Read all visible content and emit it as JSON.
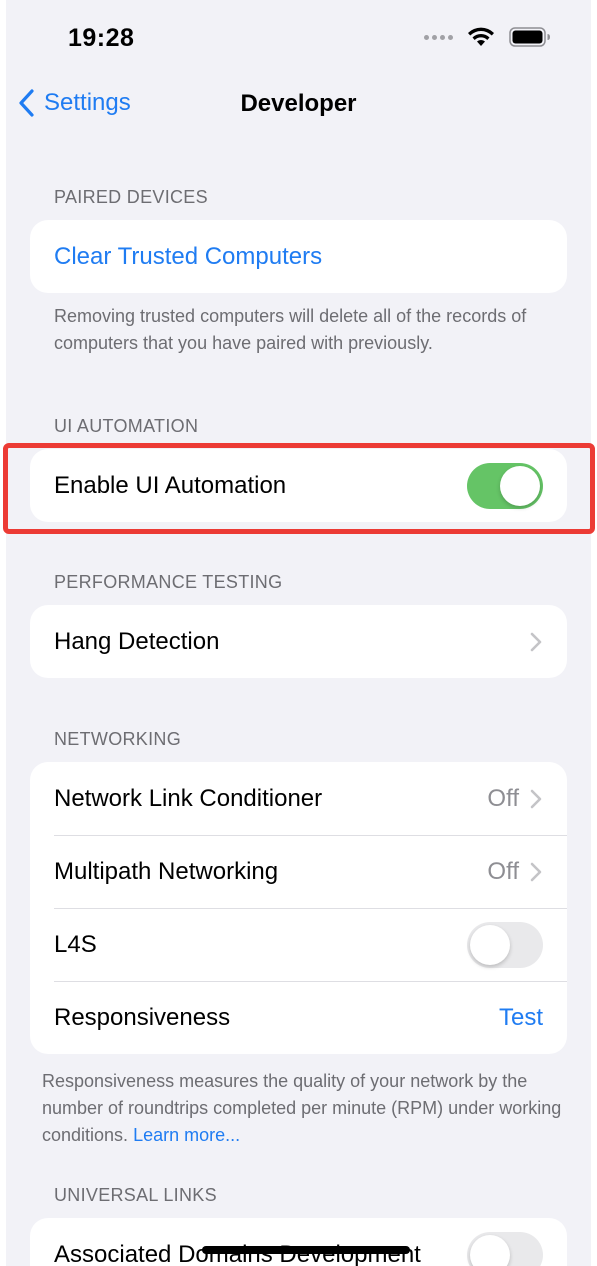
{
  "status_bar": {
    "time": "19:28"
  },
  "nav": {
    "back_label": "Settings",
    "title": "Developer"
  },
  "paired_devices": {
    "header": "PAIRED DEVICES",
    "clear_label": "Clear Trusted Computers",
    "footer": "Removing trusted computers will delete all of the records of computers that you have paired with previously."
  },
  "ui_automation": {
    "header": "UI AUTOMATION",
    "enable_label": "Enable UI Automation",
    "enabled": true
  },
  "performance_testing": {
    "header": "PERFORMANCE TESTING",
    "hang_label": "Hang Detection"
  },
  "networking": {
    "header": "NETWORKING",
    "rows": [
      {
        "label": "Network Link Conditioner",
        "value": "Off"
      },
      {
        "label": "Multipath Networking",
        "value": "Off"
      },
      {
        "label": "L4S",
        "enabled": false
      },
      {
        "label": "Responsiveness",
        "value": "Test"
      }
    ],
    "footer_text": "Responsiveness measures the quality of your network by the number of roundtrips completed per minute (RPM) under working conditions. ",
    "footer_link": "Learn more..."
  },
  "universal_links": {
    "header": "UNIVERSAL LINKS",
    "associated_label": "Associated Domains Development",
    "enabled": false
  },
  "colors": {
    "accent": "#1f7cf2",
    "toggle_on": "#65c466",
    "highlight": "#ec3b35",
    "background": "#f2f2f7"
  }
}
